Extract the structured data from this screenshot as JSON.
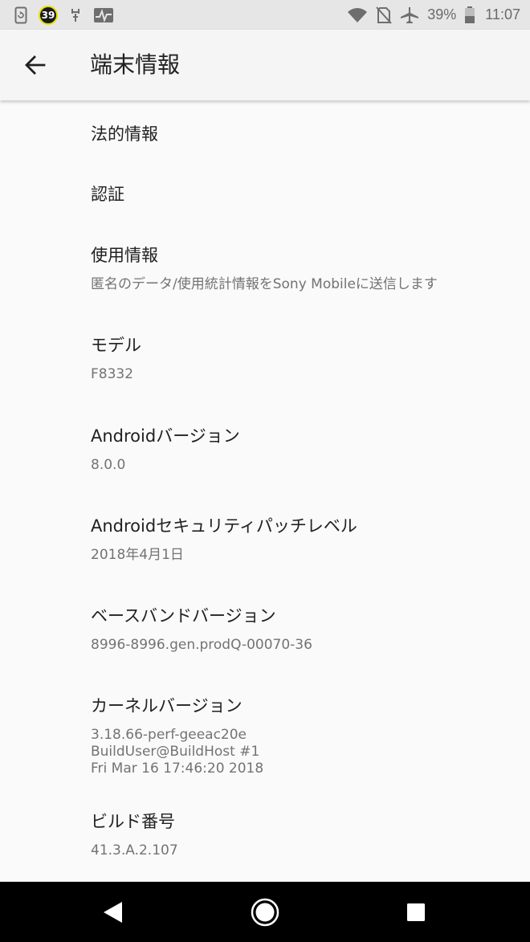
{
  "status_bar": {
    "notification_badge": "39",
    "battery_percent": "39%",
    "time": "11:07",
    "icons": [
      "screenshot-icon",
      "badge-icon",
      "usb-debug-icon",
      "pulse-icon",
      "wifi-icon",
      "no-sim-icon",
      "airplane-icon",
      "battery-icon"
    ]
  },
  "app_bar": {
    "title": "端末情報",
    "back_icon": "arrow-back-icon"
  },
  "items": [
    {
      "title": "法的情報"
    },
    {
      "title": "認証"
    },
    {
      "title": "使用情報",
      "summary": "匿名のデータ/使用統計情報をSony Mobileに送信します"
    },
    {
      "title": "モデル",
      "summary": "F8332"
    },
    {
      "title": "Androidバージョン",
      "summary": "8.0.0"
    },
    {
      "title": "Androidセキュリティパッチレベル",
      "summary": "2018年4月1日"
    },
    {
      "title": "ベースバンドバージョン",
      "summary": "8996-8996.gen.prodQ-00070-36"
    },
    {
      "title": "カーネルバージョン",
      "summary_lines": [
        "3.18.66-perf-geeac20e",
        "BuildUser@BuildHost #1",
        "Fri Mar 16 17:46:20 2018"
      ]
    },
    {
      "title": "ビルド番号",
      "summary": "41.3.A.2.107"
    }
  ],
  "nav_bar": {
    "back_icon": "nav-back-icon",
    "home_icon": "nav-home-icon",
    "recents_icon": "nav-recents-icon"
  },
  "colors": {
    "background": "#fafafa",
    "app_bar": "#f5f5f5",
    "status_bar": "#e6e6e6",
    "title_text": "#212121",
    "summary_text": "#737373",
    "nav_bar": "#000000"
  }
}
